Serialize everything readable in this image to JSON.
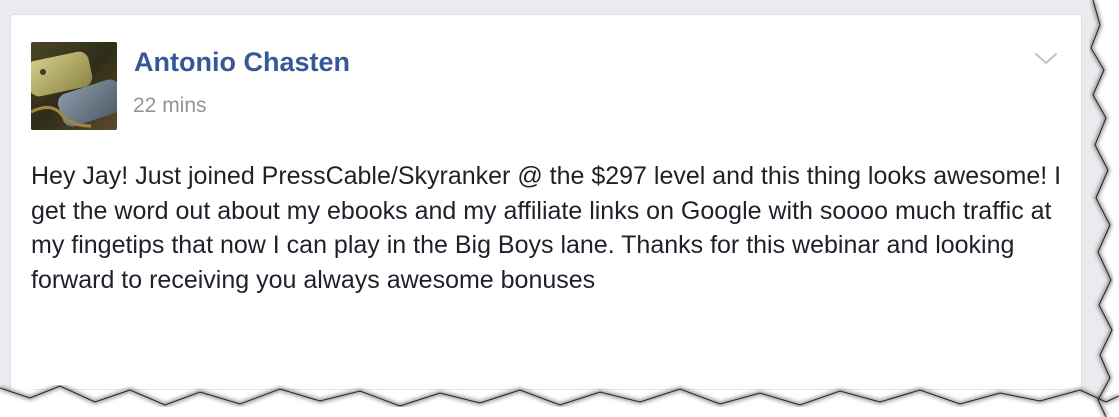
{
  "post": {
    "author_name": "Antonio Chasten",
    "timestamp": "22 mins",
    "body": "Hey Jay! Just joined PressCable/Skyranker @ the $297 level and this thing looks awesome! I get the word out about my ebooks and my affiliate links on Google with soooo much traffic at my fingetips that now I can play in the Big Boys lane. Thanks for this webinar and looking forward to receiving you always awesome bonuses",
    "menu_icon": "chevron-down-icon",
    "avatar_icon": "dog-tags-photo"
  },
  "colors": {
    "name": "#365899",
    "timestamp": "#90949c",
    "body_text": "#1d2129",
    "feed_background": "#e9ebee"
  }
}
